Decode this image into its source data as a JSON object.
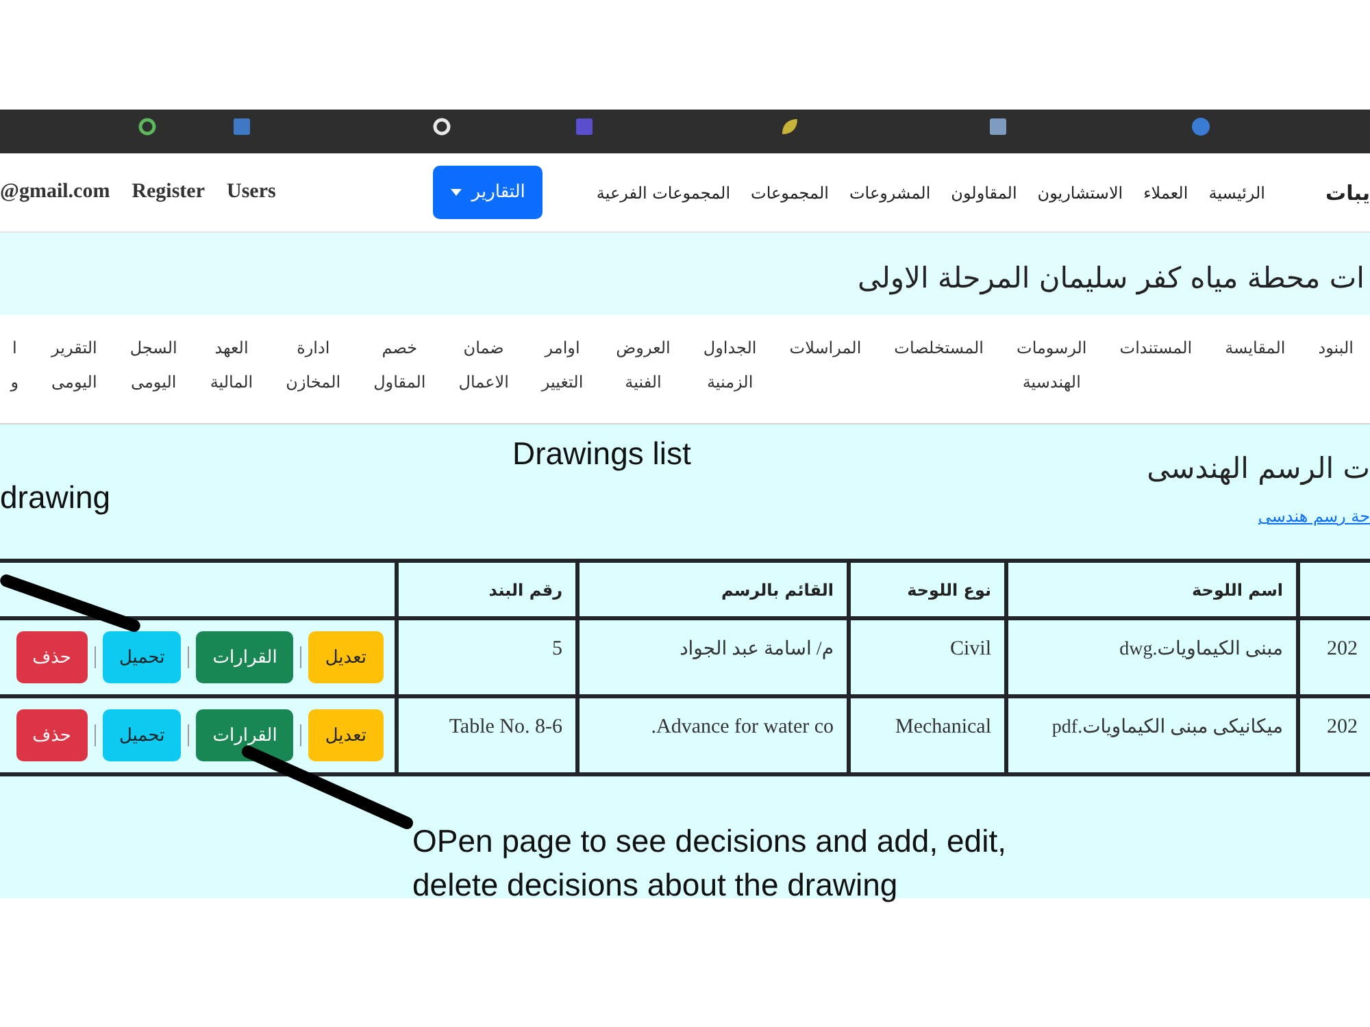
{
  "navbar": {
    "brand": "يبات",
    "links": [
      "الرئيسية",
      "العملاء",
      "الاستشاريون",
      "المقاولون",
      "المشروعات",
      "المجموعات",
      "المجموعات الفرعية"
    ],
    "dropdown": "التقارير",
    "account_links": [
      "Users",
      "Register",
      "@gmail.com"
    ]
  },
  "project_title": "ات محطة مياه كفر سليمان المرحلة الاولى",
  "project_menu": [
    "البنود",
    "المقايسة",
    "المستندات",
    "الرسومات الهندسية",
    "المستخلصات",
    "المراسلات",
    "الجداول الزمنية",
    "العروض الفنية",
    "اوامر التغيير",
    "ضمان الاعمال",
    "خصم المقاول",
    "ادارة المخازن",
    "العهد المالية",
    "السجل اليومى",
    "التقرير اليومى",
    "ا و"
  ],
  "drawings": {
    "heading": "ت الرسم الهندسى",
    "add_link": "حة رسم هندسى",
    "table": {
      "columns": [
        {
          "kind": "text"
        },
        {
          "kind": "text",
          "label": "اسم اللوحة"
        },
        {
          "kind": "text",
          "label": "نوع اللوحة"
        },
        {
          "kind": "text",
          "label": "القائم بالرسم"
        },
        {
          "kind": "text",
          "label": "رقم البند"
        },
        {
          "kind": "actions"
        }
      ],
      "rows": [
        {
          "cells": [
            "202",
            "مبنى الكيماويات.dwg",
            "Civil",
            "م/ اسامة عبد الجواد",
            "5"
          ],
          "actions": [
            {
              "kind": "edit",
              "label": "تعديل"
            },
            {
              "kind": "decisions",
              "label": "القرارات"
            },
            {
              "kind": "download",
              "label": "تحميل"
            },
            {
              "kind": "delete",
              "label": "حذف"
            }
          ]
        },
        {
          "cells": [
            "202",
            "ميكانيكى مبنى الكيماويات.pdf",
            "Mechanical",
            ".Advance for water co",
            "Table No. 8-6"
          ],
          "actions": [
            {
              "kind": "edit",
              "label": "تعديل"
            },
            {
              "kind": "decisions",
              "label": "القرارات"
            },
            {
              "kind": "download",
              "label": "تحميل"
            },
            {
              "kind": "delete",
              "label": "حذف"
            }
          ]
        }
      ]
    }
  },
  "annotations": [
    {
      "text": "Drawings list"
    },
    {
      "text": "drawing"
    },
    {
      "text": "OPen page to see decisions and add, edit, delete decisions about the drawing"
    }
  ]
}
